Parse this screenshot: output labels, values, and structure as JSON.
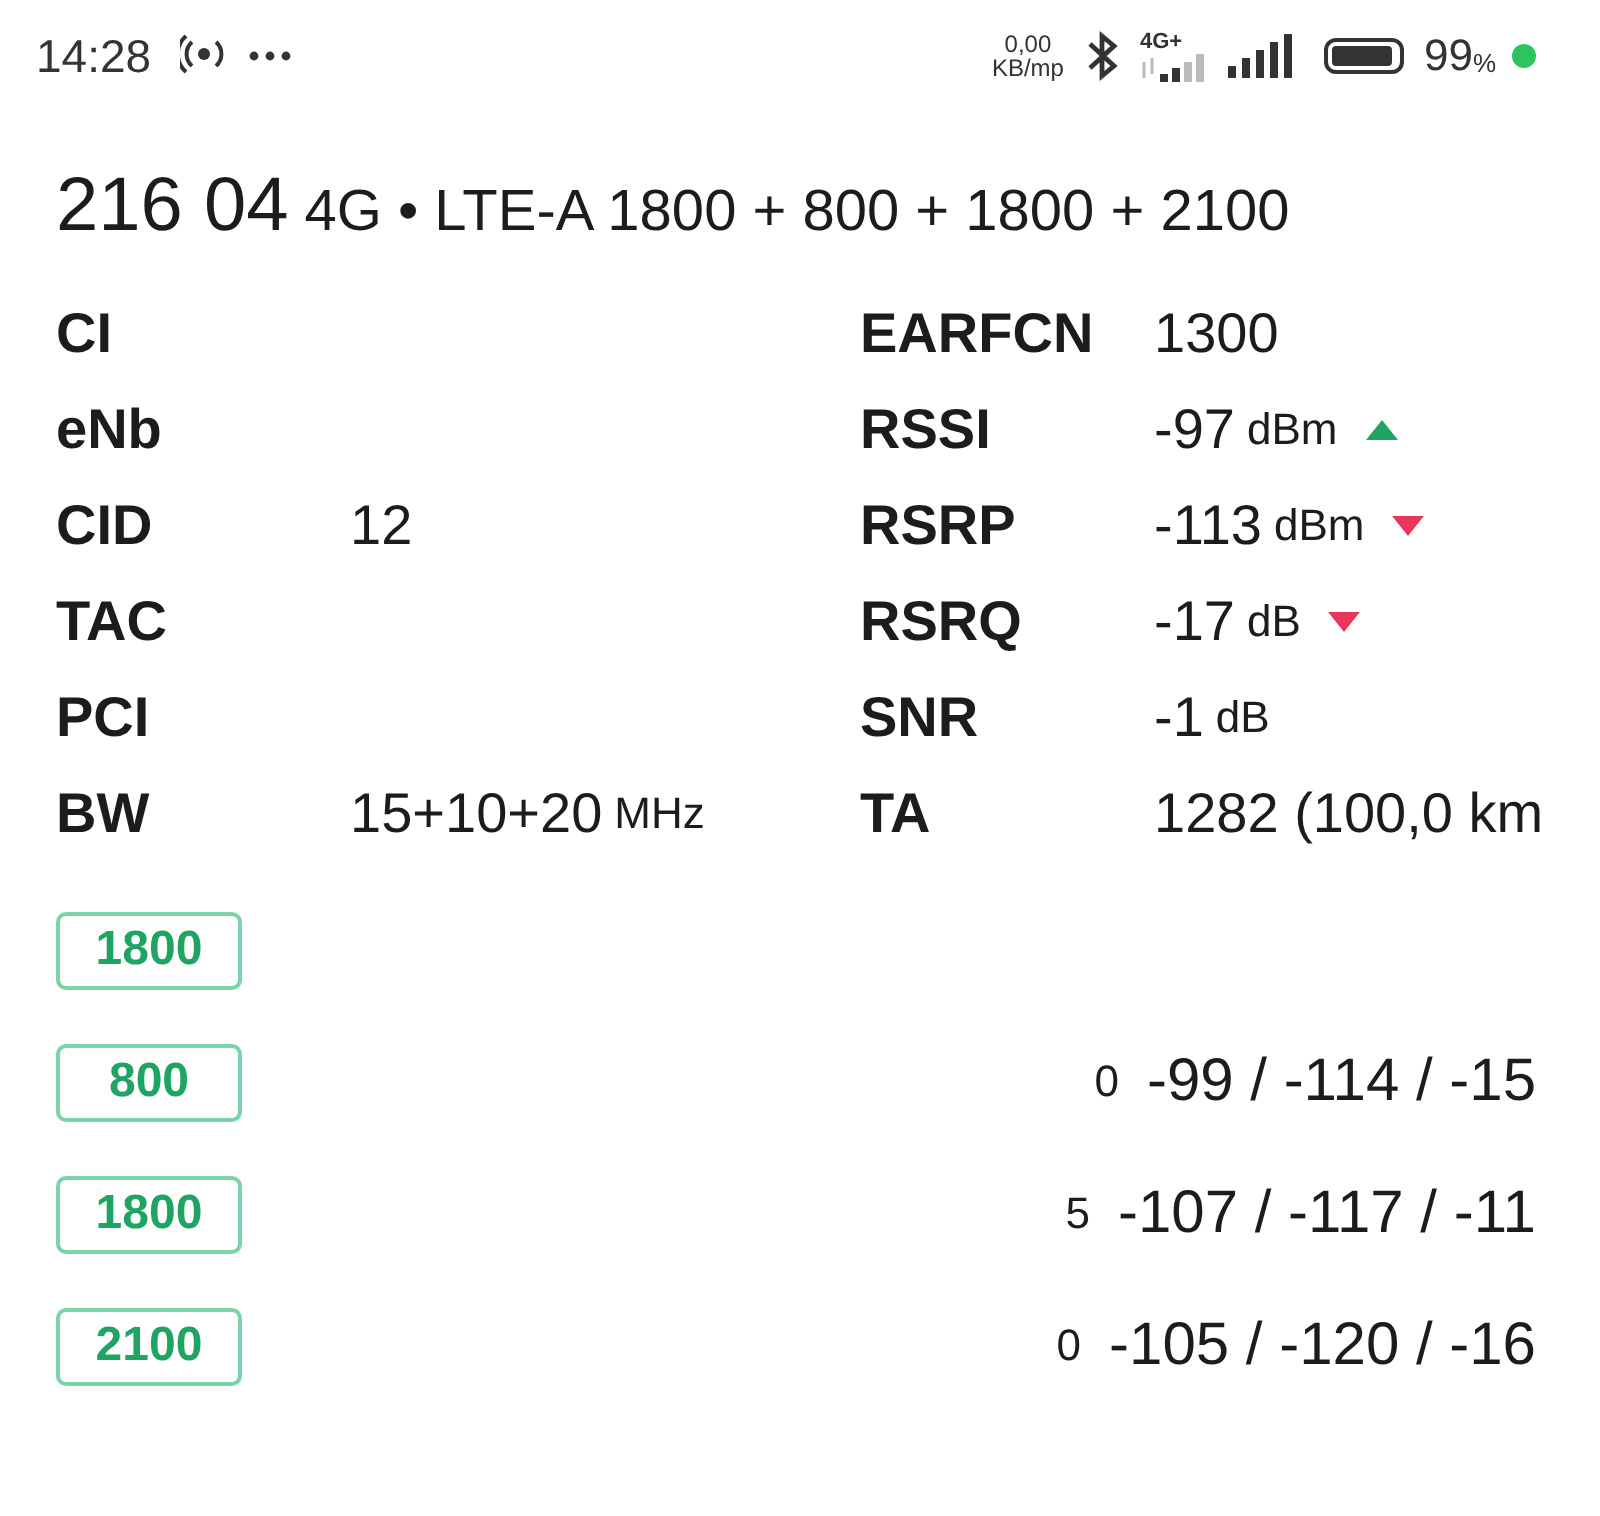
{
  "status_bar": {
    "time": "14:28",
    "speed_value": "0,00",
    "speed_unit": "KB/mp",
    "network_type": "4G+",
    "battery_percent": "99",
    "battery_unit": "%"
  },
  "header": {
    "operator": "216 04",
    "technology": "4G • LTE-A 1800 + 800 + 1800 + 2100"
  },
  "left_fields": [
    {
      "label": "CI"
    },
    {
      "label": "eNb"
    },
    {
      "label": "CID",
      "value": "12"
    },
    {
      "label": "TAC"
    },
    {
      "label": "PCI"
    },
    {
      "label": "BW",
      "value": "15+10+20",
      "unit": "MHz"
    }
  ],
  "right_fields": [
    {
      "kind": "plain",
      "label": "EARFCN",
      "value": "1300"
    },
    {
      "kind": "rising",
      "label": "RSSI",
      "value": "-97",
      "unit": "dBm"
    },
    {
      "kind": "falling",
      "label": "RSRP",
      "value": "-113",
      "unit": "dBm"
    },
    {
      "kind": "falling",
      "label": "RSRQ",
      "value": "-17",
      "unit": "dB"
    },
    {
      "kind": "plain",
      "label": "SNR",
      "value": "-1",
      "unit": "dB"
    },
    {
      "kind": "plain",
      "label": "TA",
      "value": "1282 (100,0 km"
    }
  ],
  "carriers": [
    {
      "band": "1800"
    },
    {
      "band": "800",
      "fragment": "0",
      "reading": "-99 / -114 / -15"
    },
    {
      "band": "1800",
      "fragment": "5",
      "reading": "-107 / -117 / -11"
    },
    {
      "band": "2100",
      "fragment": "0",
      "reading": "-105 / -120 / -16"
    }
  ]
}
